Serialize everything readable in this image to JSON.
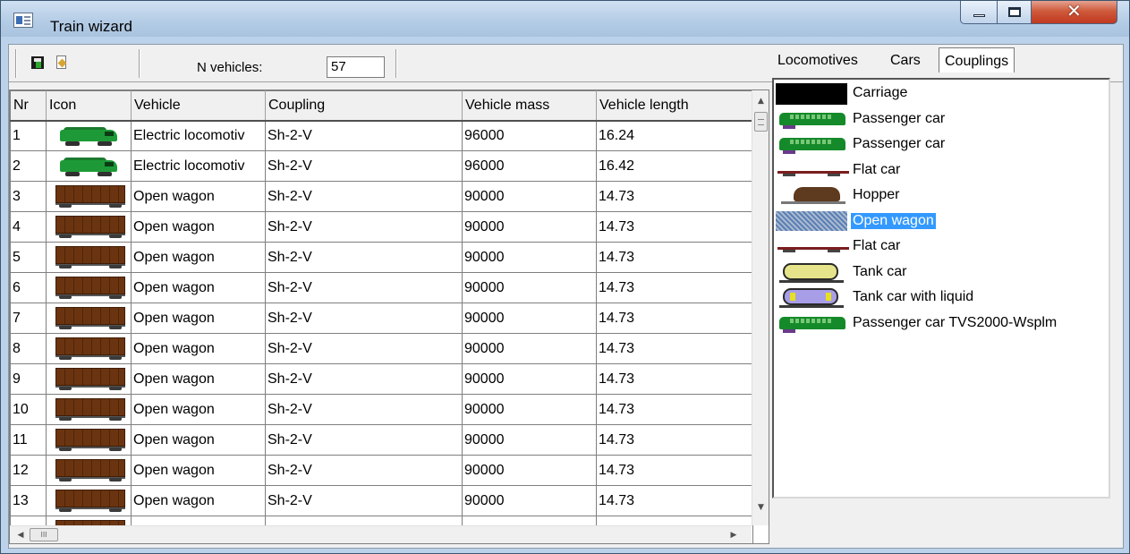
{
  "window": {
    "title": "Train wizard"
  },
  "toolbar": {
    "n_vehicles_label": "N vehicles:",
    "n_vehicles_value": "57"
  },
  "grid": {
    "columns": [
      "Nr",
      "Icon",
      "Vehicle",
      "Coupling",
      "Vehicle mass",
      "Vehicle length"
    ],
    "rows": [
      {
        "nr": "1",
        "icon": "electric-locomotive-icon",
        "vehicle": "Electric locomotiv",
        "coupling": "Sh-2-V",
        "mass": "96000",
        "length": "16.24"
      },
      {
        "nr": "2",
        "icon": "electric-locomotive-icon",
        "vehicle": "Electric locomotiv",
        "coupling": "Sh-2-V",
        "mass": "96000",
        "length": "16.42"
      },
      {
        "nr": "3",
        "icon": "open-wagon-icon",
        "vehicle": "Open wagon",
        "coupling": "Sh-2-V",
        "mass": "90000",
        "length": "14.73"
      },
      {
        "nr": "4",
        "icon": "open-wagon-icon",
        "vehicle": "Open wagon",
        "coupling": "Sh-2-V",
        "mass": "90000",
        "length": "14.73"
      },
      {
        "nr": "5",
        "icon": "open-wagon-icon",
        "vehicle": "Open wagon",
        "coupling": "Sh-2-V",
        "mass": "90000",
        "length": "14.73"
      },
      {
        "nr": "6",
        "icon": "open-wagon-icon",
        "vehicle": "Open wagon",
        "coupling": "Sh-2-V",
        "mass": "90000",
        "length": "14.73"
      },
      {
        "nr": "7",
        "icon": "open-wagon-icon",
        "vehicle": "Open wagon",
        "coupling": "Sh-2-V",
        "mass": "90000",
        "length": "14.73"
      },
      {
        "nr": "8",
        "icon": "open-wagon-icon",
        "vehicle": "Open wagon",
        "coupling": "Sh-2-V",
        "mass": "90000",
        "length": "14.73"
      },
      {
        "nr": "9",
        "icon": "open-wagon-icon",
        "vehicle": "Open wagon",
        "coupling": "Sh-2-V",
        "mass": "90000",
        "length": "14.73"
      },
      {
        "nr": "10",
        "icon": "open-wagon-icon",
        "vehicle": "Open wagon",
        "coupling": "Sh-2-V",
        "mass": "90000",
        "length": "14.73"
      },
      {
        "nr": "11",
        "icon": "open-wagon-icon",
        "vehicle": "Open wagon",
        "coupling": "Sh-2-V",
        "mass": "90000",
        "length": "14.73"
      },
      {
        "nr": "12",
        "icon": "open-wagon-icon",
        "vehicle": "Open wagon",
        "coupling": "Sh-2-V",
        "mass": "90000",
        "length": "14.73"
      },
      {
        "nr": "13",
        "icon": "open-wagon-icon",
        "vehicle": "Open wagon",
        "coupling": "Sh-2-V",
        "mass": "90000",
        "length": "14.73"
      }
    ]
  },
  "tabs": [
    "Locomotives",
    "Cars",
    "Couplings"
  ],
  "active_tab": "Cars",
  "cars_list": [
    {
      "label": "Carriage",
      "icon": "carriage-icon"
    },
    {
      "label": "Passenger car",
      "icon": "passenger-car-icon"
    },
    {
      "label": "Passenger car",
      "icon": "passenger-car-icon"
    },
    {
      "label": "Flat car",
      "icon": "flat-car-icon"
    },
    {
      "label": "Hopper",
      "icon": "hopper-icon"
    },
    {
      "label": "Open wagon",
      "icon": "open-wagon-icon",
      "selected": true
    },
    {
      "label": "Flat car",
      "icon": "flat-car-icon"
    },
    {
      "label": "Tank car",
      "icon": "tank-car-icon"
    },
    {
      "label": "Tank car with liquid",
      "icon": "tank-car-liquid-icon"
    },
    {
      "label": "Passenger car TVS2000-Wsplm",
      "icon": "passenger-car-icon"
    }
  ],
  "scrollbar_glyphs": {
    "up": "▲",
    "down": "▼",
    "left": "◀",
    "right": "▶",
    "grip": "III"
  }
}
